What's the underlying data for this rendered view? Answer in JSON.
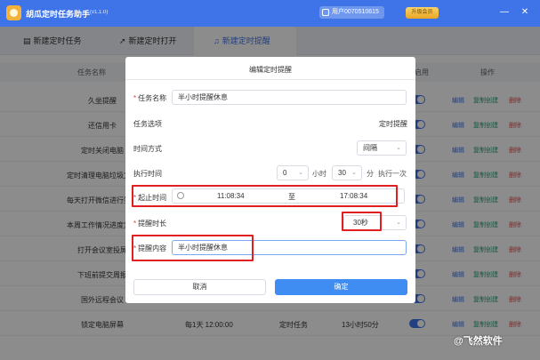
{
  "app": {
    "title": "胡瓜定时任务助手",
    "version": "(v1.1.0)"
  },
  "user": {
    "label": "用户0070510615"
  },
  "vip": {
    "label": "升级会员"
  },
  "window": {
    "min": "—",
    "close": "✕"
  },
  "tabs": [
    {
      "label": "新建定时任务",
      "icon": "list-icon"
    },
    {
      "label": "新建定时打开",
      "icon": "rocket-icon"
    },
    {
      "label": "新建定时提醒",
      "icon": "bell-icon"
    }
  ],
  "table": {
    "headers": {
      "name": "任务名称",
      "enable": "启用",
      "ops": "操作"
    },
    "rows": [
      {
        "name": "久坐提醒"
      },
      {
        "name": "还信用卡"
      },
      {
        "name": "定时关闭电脑"
      },
      {
        "name": "定时清理电脑垃圾文件"
      },
      {
        "name": "每天打开微信进行签到"
      },
      {
        "name": "本周工作情况进度复写"
      },
      {
        "name": "打开会议室投屏"
      },
      {
        "name": "下班前提交周报"
      },
      {
        "name": "国外远程会议"
      },
      {
        "name": "锁定电脑屏幕",
        "time": "每1天 12:00:00",
        "type": "定时任务",
        "left": "13小时50分"
      }
    ],
    "actions": {
      "edit": "编辑",
      "copy": "复制创建",
      "delete": "删除"
    }
  },
  "dialog": {
    "title": "编辑定时提醒",
    "task_name_label": "任务名称",
    "task_name_value": "半小时提醒休息",
    "task_option_label": "任务选项",
    "task_option_value": "定时提醒",
    "time_mode_label": "时间方式",
    "time_mode_value": "间隔",
    "exec_time_label": "执行时间",
    "exec_hours": "0",
    "hours_unit": "小时",
    "exec_minutes": "30",
    "minutes_unit": "分",
    "exec_once": "执行一次",
    "range_label": "起止时间",
    "range_start": "11:08:34",
    "range_to": "至",
    "range_end": "17:08:34",
    "duration_label": "提醒时长",
    "duration_value": "30秒",
    "content_label": "提醒内容",
    "content_value": "半小时提醒休息",
    "cancel": "取消",
    "ok": "确定"
  },
  "watermark": "@飞然软件",
  "colors": {
    "accent": "#3f74e8",
    "highlight": "#e02020"
  }
}
